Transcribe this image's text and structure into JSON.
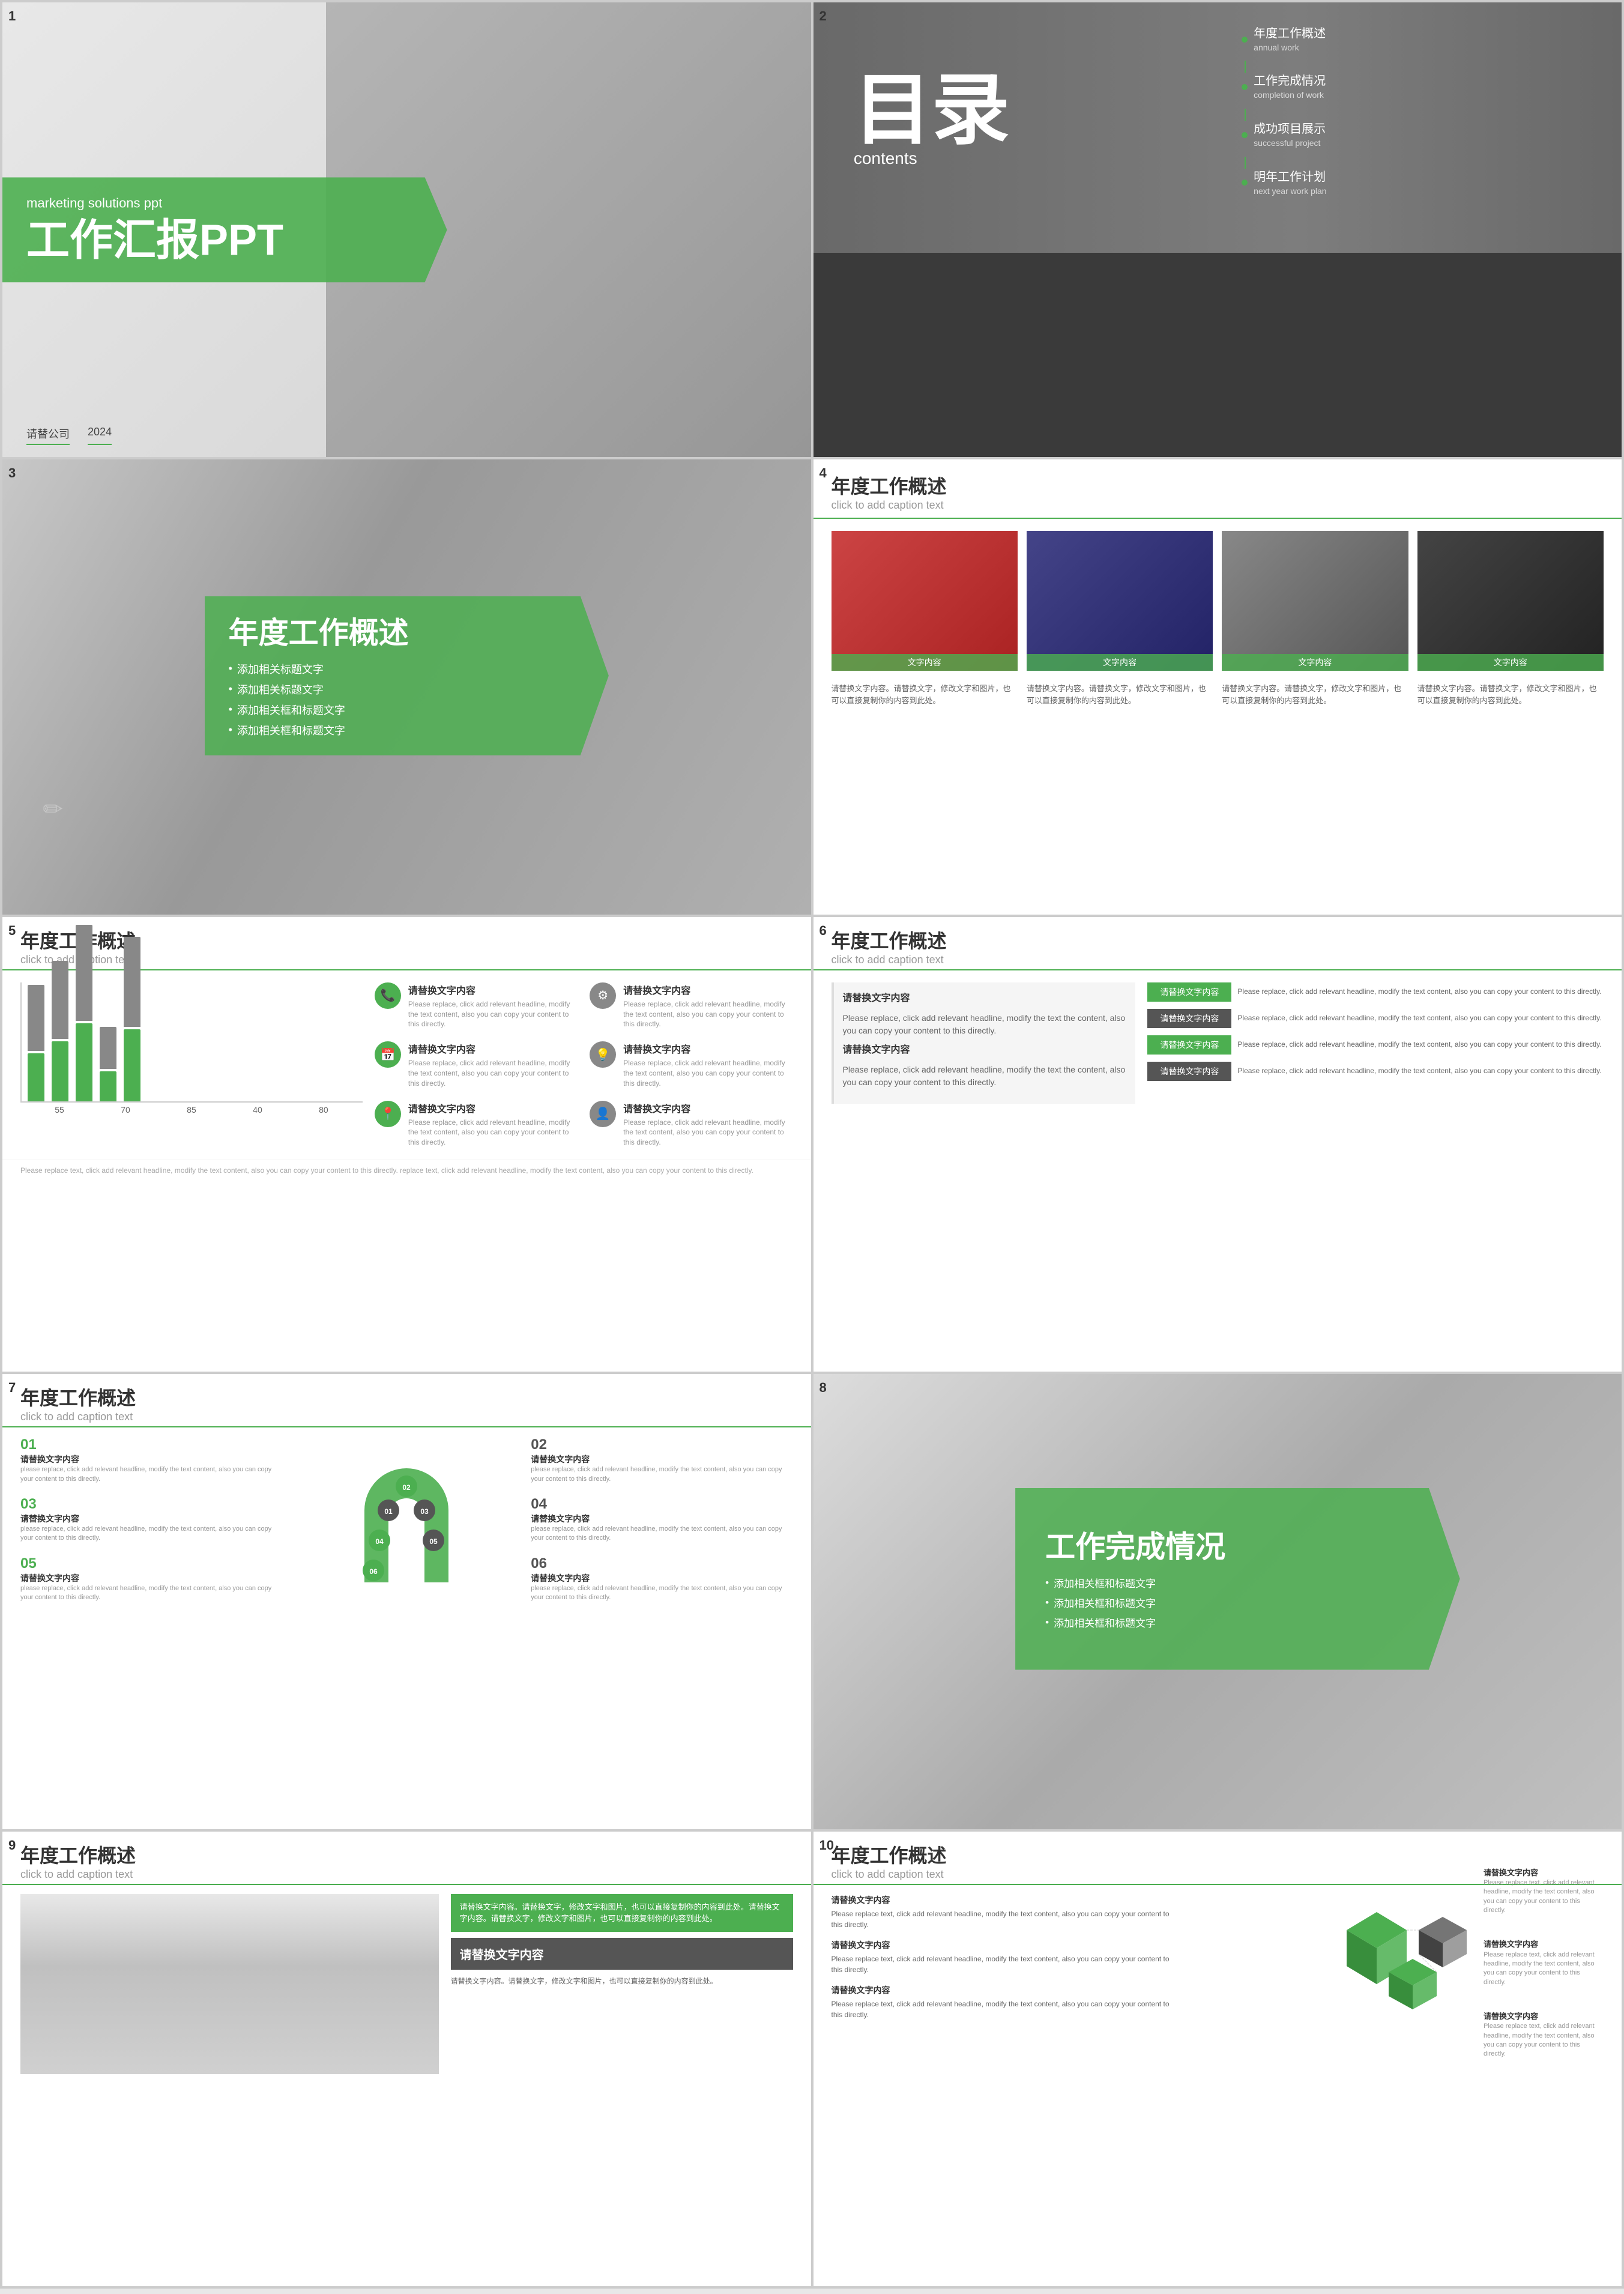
{
  "slides": [
    {
      "number": "1",
      "subtitle": "marketing solutions ppt",
      "title": "工作汇报PPT",
      "footer": [
        "请替公司",
        "2024"
      ]
    },
    {
      "number": "2",
      "main_title": "目录",
      "sub": "contents",
      "items": [
        {
          "text": "年度工作概述",
          "sub": "annual work"
        },
        {
          "text": "工作完成情况",
          "sub": "completion of work"
        },
        {
          "text": "成功项目展示",
          "sub": "successful project"
        },
        {
          "text": "明年工作计划",
          "sub": "next year work plan"
        }
      ]
    },
    {
      "number": "3",
      "title": "年度工作概述",
      "bullets": [
        "添加相关标题文字",
        "添加相关标题文字",
        "添加相关框和标题文字",
        "添加相关框和标题文字"
      ]
    },
    {
      "number": "4",
      "title": "年度工作概述",
      "caption": "click to add caption text",
      "photos": [
        {
          "label": "文字内容",
          "desc": "请替换文字内容"
        },
        {
          "label": "文字内容",
          "desc": "请替换文字内容"
        },
        {
          "label": "文字内容",
          "desc": "请替换文字内容"
        },
        {
          "label": "文字内容",
          "desc": "请替换文字内容"
        }
      ],
      "text_cols": [
        "请替换文字内容。请替换文字，修改文字和图片，也可以直接复制你的内容到此处。",
        "请替换文字内容。请替换文字，修改文字和图片，也可以直接复制你的内容到此处。",
        "请替换文字内容。请替换文字，修改文字和图片，也可以直接复制你的内容到此处。",
        "请替换文字内容。请替换文字，修改文字和图片，也可以直接复制你的内容到此处。"
      ]
    },
    {
      "number": "5",
      "title": "年度工作概述",
      "caption": "click to add caption text",
      "chart_values": [
        55,
        70,
        85,
        40,
        80
      ],
      "chart_labels": [
        "55",
        "70",
        "85",
        "40",
        "80"
      ],
      "icons": [
        {
          "type": "phone",
          "title": "请替换文字内容",
          "desc": "Please replace, click add relevant headline, modify the text content, also you can copy your content to this directly."
        },
        {
          "type": "gear",
          "title": "请替换文字内容",
          "desc": "Please replace, click add relevant headline, modify the text content, also you can copy your content to this directly."
        },
        {
          "type": "calendar",
          "title": "请替换文字内容",
          "desc": "Please replace, click add relevant headline, modify the text content, also you can copy your content to this directly."
        },
        {
          "type": "bulb",
          "title": "请替换文字内容",
          "desc": "Please replace, click add relevant headline, modify the text content, also you can copy your content to this directly."
        },
        {
          "type": "pin",
          "title": "请替换文字内容",
          "desc": "Please replace, click add relevant headline, modify the text content, also you can copy your content to this directly."
        },
        {
          "type": "person",
          "title": "请替换文字内容",
          "desc": "Please replace, click add relevant headline, modify the text content, also you can copy your content to this directly."
        }
      ],
      "footer": "Please replace text, click add relevant headline, modify the text content, also you can copy your content to this directly. replace text, click add relevant headline, modify the text content, also you can copy your content to this directly."
    },
    {
      "number": "6",
      "title": "年度工作概述",
      "caption": "click to add caption text",
      "left_texts": [
        "请替换文字内容",
        "Please replace, click add relevant headline, modify the text the content, also you can copy your content to this directly.",
        "请替换文字内容",
        "Please replace, click add relevant headline, modify the text the content, also you can copy your content to this directly."
      ],
      "rows": [
        {
          "tag": "请替换文字内容",
          "type": "green",
          "desc": "Please replace, click add relevant headline, modify the text content, also you can copy your content to this directly."
        },
        {
          "tag": "请替换文字内容",
          "type": "dark",
          "desc": "Please replace, click add relevant headline, modify the text content, also you can copy your content to this directly."
        },
        {
          "tag": "请替换文字内容",
          "type": "green",
          "desc": "Please replace, click add relevant headline, modify the text content, also you can copy your content to this directly."
        },
        {
          "tag": "请替换文字内容",
          "type": "dark",
          "desc": "Please replace, click add relevant headline, modify the text content, also you can copy your content to this directly."
        }
      ]
    },
    {
      "number": "7",
      "title": "年度工作概述",
      "caption": "click to add caption text",
      "items_left": [
        {
          "num": "01",
          "color": "green",
          "title": "请替换文字内容",
          "desc": "please replace, click add relevant headline, modify the text content, also you can copy your content to this directly."
        },
        {
          "num": "03",
          "color": "green",
          "title": "请替换文字内容",
          "desc": "please replace, click add relevant headline, modify the text content, also you can copy your content to this directly."
        },
        {
          "num": "05",
          "color": "green",
          "title": "请替换文字内容",
          "desc": "please replace, click add relevant headline, modify the text content, also you can copy your content to this directly."
        }
      ],
      "items_right": [
        {
          "num": "02",
          "color": "dark",
          "title": "请替换文字内容",
          "desc": "please replace, click add relevant headline, modify the text content, also you can copy your content to this directly."
        },
        {
          "num": "04",
          "color": "dark",
          "title": "请替换文字内容",
          "desc": "please replace, click add relevant headline, modify the text content, also you can copy your content to this directly."
        },
        {
          "num": "06",
          "color": "dark",
          "title": "请替换文字内容",
          "desc": "please replace, click add relevant headline, modify the text content, also you can copy your content to this directly."
        }
      ]
    },
    {
      "number": "8",
      "title": "工作完成情况",
      "bullets": [
        "添加相关框和标题文字",
        "添加相关框和标题文字",
        "添加相关框和标题文字"
      ]
    },
    {
      "number": "9",
      "title": "年度工作概述",
      "caption": "click to add caption text",
      "text_block": "请替换文字内容。请替换文字，修改文字和图片，也可以直接复制你的内容到此处。请替换文字内容。请替换文字，修改文字和图片，也可以直接复制你的内容到此处。",
      "dark_label": "请替换文字内容",
      "desc": "请替换文字内容。请替换文字，修改文字和图片，也可以直接复制你的内容到此处。"
    },
    {
      "number": "10",
      "title": "年度工作概述",
      "caption": "click to add caption text",
      "text_items": [
        {
          "title": "请替换文字内容",
          "desc": "Please replace text, click add relevant headline, modify the text content, also you can copy your content to this directly."
        },
        {
          "title": "请替换文字内容",
          "desc": "Please replace text, click add relevant headline, modify the text content, also you can copy your content to this directly."
        },
        {
          "title": "请替换文字内容",
          "desc": "Please replace text, click add relevant headline, modify the text content, also you can copy your content to this directly."
        }
      ],
      "right_labels": [
        "请替换文字内容\nPlease replace text, click add relevant headline, modify the text content.",
        "请替换文字内容\nPlease replace text, click add relevant headline, modify the text content.",
        "请替换文字内容\nPlease replace text, click add relevant headline, modify the text content."
      ],
      "colors": {
        "accent": "#4CAF50"
      }
    }
  ],
  "brand": {
    "accent_color": "#4CAF50",
    "dark_color": "#555555"
  }
}
